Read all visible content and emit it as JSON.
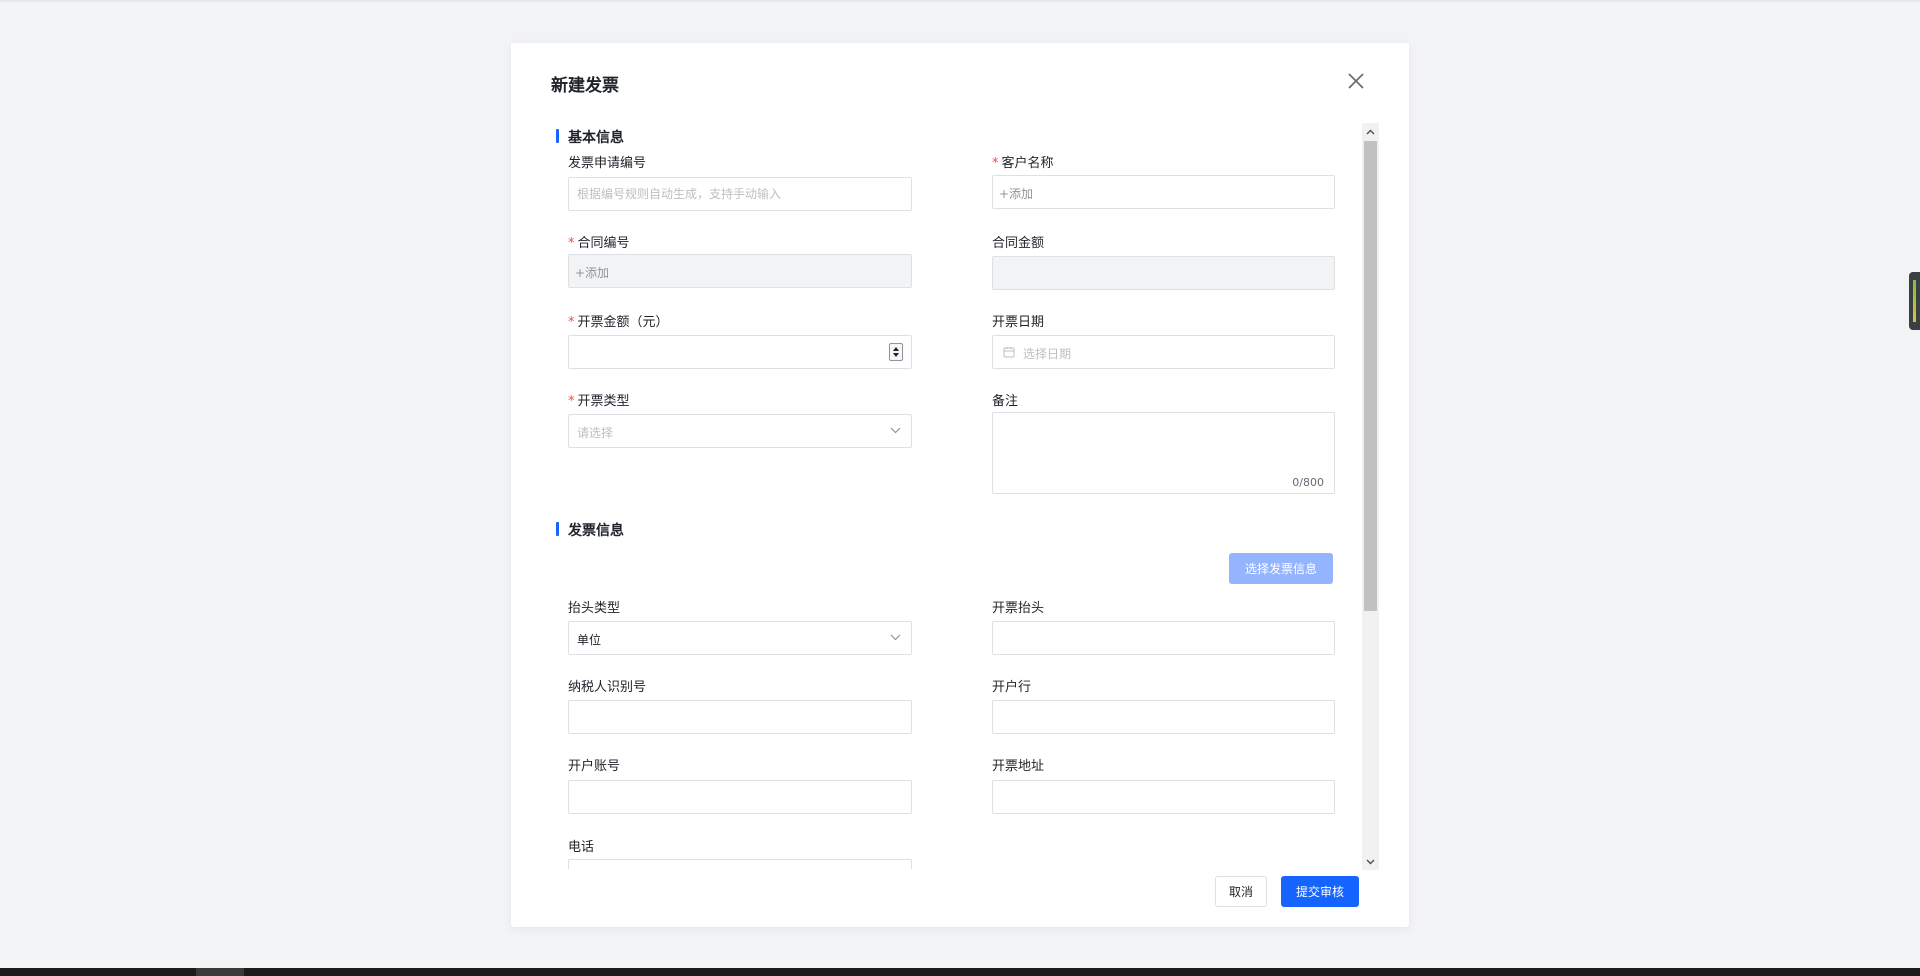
{
  "modal": {
    "title": "新建发票",
    "close_icon": "close-icon"
  },
  "sections": {
    "basic": "基本信息",
    "invoice": "发票信息"
  },
  "fields": {
    "invoice_no": {
      "label": "发票申请编号",
      "placeholder": "根据编号规则自动生成，支持手动输入",
      "required": false
    },
    "customer_name": {
      "label": "客户名称",
      "value": "+添加",
      "required": true
    },
    "contract_no": {
      "label": "合同编号",
      "value": "+添加",
      "required": true
    },
    "contract_amount": {
      "label": "合同金额",
      "value": "",
      "required": false
    },
    "invoice_amount": {
      "label": "开票金额（元）",
      "value": "",
      "required": true
    },
    "invoice_date": {
      "label": "开票日期",
      "placeholder": "选择日期",
      "required": false
    },
    "invoice_type": {
      "label": "开票类型",
      "placeholder": "请选择",
      "required": true
    },
    "remark": {
      "label": "备注",
      "counter": "0/800",
      "required": false
    },
    "title_type": {
      "label": "抬头类型",
      "value": "单位"
    },
    "invoice_title": {
      "label": "开票抬头",
      "value": ""
    },
    "taxpayer_id": {
      "label": "纳税人识别号",
      "value": ""
    },
    "bank": {
      "label": "开户行",
      "value": ""
    },
    "bank_account": {
      "label": "开户账号",
      "value": ""
    },
    "invoice_address": {
      "label": "开票地址",
      "value": ""
    },
    "phone": {
      "label": "电话",
      "value": ""
    }
  },
  "buttons": {
    "select_invoice_info": "选择发票信息",
    "cancel": "取消",
    "submit": "提交审核"
  },
  "required_mark": "*",
  "colors": {
    "primary": "#1664ff",
    "primary_disabled": "#94b4ff",
    "required": "#f54a45"
  }
}
